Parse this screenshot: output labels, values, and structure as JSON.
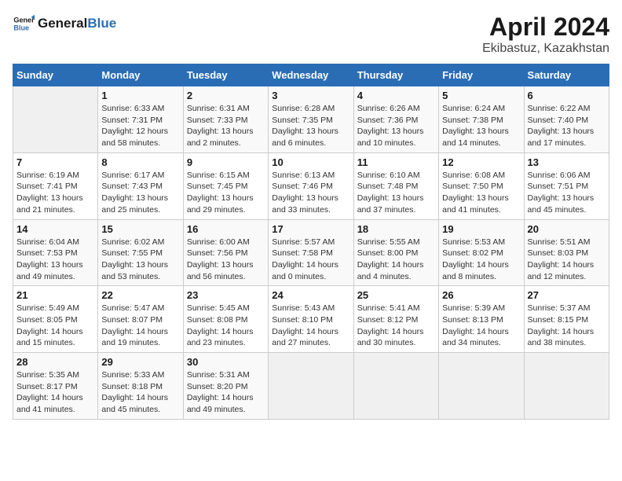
{
  "header": {
    "logo_general": "General",
    "logo_blue": "Blue",
    "title": "April 2024",
    "subtitle": "Ekibastuz, Kazakhstan"
  },
  "calendar": {
    "days_of_week": [
      "Sunday",
      "Monday",
      "Tuesday",
      "Wednesday",
      "Thursday",
      "Friday",
      "Saturday"
    ],
    "weeks": [
      [
        {
          "day": "",
          "sunrise": "",
          "sunset": "",
          "daylight": ""
        },
        {
          "day": "1",
          "sunrise": "Sunrise: 6:33 AM",
          "sunset": "Sunset: 7:31 PM",
          "daylight": "Daylight: 12 hours and 58 minutes."
        },
        {
          "day": "2",
          "sunrise": "Sunrise: 6:31 AM",
          "sunset": "Sunset: 7:33 PM",
          "daylight": "Daylight: 13 hours and 2 minutes."
        },
        {
          "day": "3",
          "sunrise": "Sunrise: 6:28 AM",
          "sunset": "Sunset: 7:35 PM",
          "daylight": "Daylight: 13 hours and 6 minutes."
        },
        {
          "day": "4",
          "sunrise": "Sunrise: 6:26 AM",
          "sunset": "Sunset: 7:36 PM",
          "daylight": "Daylight: 13 hours and 10 minutes."
        },
        {
          "day": "5",
          "sunrise": "Sunrise: 6:24 AM",
          "sunset": "Sunset: 7:38 PM",
          "daylight": "Daylight: 13 hours and 14 minutes."
        },
        {
          "day": "6",
          "sunrise": "Sunrise: 6:22 AM",
          "sunset": "Sunset: 7:40 PM",
          "daylight": "Daylight: 13 hours and 17 minutes."
        }
      ],
      [
        {
          "day": "7",
          "sunrise": "Sunrise: 6:19 AM",
          "sunset": "Sunset: 7:41 PM",
          "daylight": "Daylight: 13 hours and 21 minutes."
        },
        {
          "day": "8",
          "sunrise": "Sunrise: 6:17 AM",
          "sunset": "Sunset: 7:43 PM",
          "daylight": "Daylight: 13 hours and 25 minutes."
        },
        {
          "day": "9",
          "sunrise": "Sunrise: 6:15 AM",
          "sunset": "Sunset: 7:45 PM",
          "daylight": "Daylight: 13 hours and 29 minutes."
        },
        {
          "day": "10",
          "sunrise": "Sunrise: 6:13 AM",
          "sunset": "Sunset: 7:46 PM",
          "daylight": "Daylight: 13 hours and 33 minutes."
        },
        {
          "day": "11",
          "sunrise": "Sunrise: 6:10 AM",
          "sunset": "Sunset: 7:48 PM",
          "daylight": "Daylight: 13 hours and 37 minutes."
        },
        {
          "day": "12",
          "sunrise": "Sunrise: 6:08 AM",
          "sunset": "Sunset: 7:50 PM",
          "daylight": "Daylight: 13 hours and 41 minutes."
        },
        {
          "day": "13",
          "sunrise": "Sunrise: 6:06 AM",
          "sunset": "Sunset: 7:51 PM",
          "daylight": "Daylight: 13 hours and 45 minutes."
        }
      ],
      [
        {
          "day": "14",
          "sunrise": "Sunrise: 6:04 AM",
          "sunset": "Sunset: 7:53 PM",
          "daylight": "Daylight: 13 hours and 49 minutes."
        },
        {
          "day": "15",
          "sunrise": "Sunrise: 6:02 AM",
          "sunset": "Sunset: 7:55 PM",
          "daylight": "Daylight: 13 hours and 53 minutes."
        },
        {
          "day": "16",
          "sunrise": "Sunrise: 6:00 AM",
          "sunset": "Sunset: 7:56 PM",
          "daylight": "Daylight: 13 hours and 56 minutes."
        },
        {
          "day": "17",
          "sunrise": "Sunrise: 5:57 AM",
          "sunset": "Sunset: 7:58 PM",
          "daylight": "Daylight: 14 hours and 0 minutes."
        },
        {
          "day": "18",
          "sunrise": "Sunrise: 5:55 AM",
          "sunset": "Sunset: 8:00 PM",
          "daylight": "Daylight: 14 hours and 4 minutes."
        },
        {
          "day": "19",
          "sunrise": "Sunrise: 5:53 AM",
          "sunset": "Sunset: 8:02 PM",
          "daylight": "Daylight: 14 hours and 8 minutes."
        },
        {
          "day": "20",
          "sunrise": "Sunrise: 5:51 AM",
          "sunset": "Sunset: 8:03 PM",
          "daylight": "Daylight: 14 hours and 12 minutes."
        }
      ],
      [
        {
          "day": "21",
          "sunrise": "Sunrise: 5:49 AM",
          "sunset": "Sunset: 8:05 PM",
          "daylight": "Daylight: 14 hours and 15 minutes."
        },
        {
          "day": "22",
          "sunrise": "Sunrise: 5:47 AM",
          "sunset": "Sunset: 8:07 PM",
          "daylight": "Daylight: 14 hours and 19 minutes."
        },
        {
          "day": "23",
          "sunrise": "Sunrise: 5:45 AM",
          "sunset": "Sunset: 8:08 PM",
          "daylight": "Daylight: 14 hours and 23 minutes."
        },
        {
          "day": "24",
          "sunrise": "Sunrise: 5:43 AM",
          "sunset": "Sunset: 8:10 PM",
          "daylight": "Daylight: 14 hours and 27 minutes."
        },
        {
          "day": "25",
          "sunrise": "Sunrise: 5:41 AM",
          "sunset": "Sunset: 8:12 PM",
          "daylight": "Daylight: 14 hours and 30 minutes."
        },
        {
          "day": "26",
          "sunrise": "Sunrise: 5:39 AM",
          "sunset": "Sunset: 8:13 PM",
          "daylight": "Daylight: 14 hours and 34 minutes."
        },
        {
          "day": "27",
          "sunrise": "Sunrise: 5:37 AM",
          "sunset": "Sunset: 8:15 PM",
          "daylight": "Daylight: 14 hours and 38 minutes."
        }
      ],
      [
        {
          "day": "28",
          "sunrise": "Sunrise: 5:35 AM",
          "sunset": "Sunset: 8:17 PM",
          "daylight": "Daylight: 14 hours and 41 minutes."
        },
        {
          "day": "29",
          "sunrise": "Sunrise: 5:33 AM",
          "sunset": "Sunset: 8:18 PM",
          "daylight": "Daylight: 14 hours and 45 minutes."
        },
        {
          "day": "30",
          "sunrise": "Sunrise: 5:31 AM",
          "sunset": "Sunset: 8:20 PM",
          "daylight": "Daylight: 14 hours and 49 minutes."
        },
        {
          "day": "",
          "sunrise": "",
          "sunset": "",
          "daylight": ""
        },
        {
          "day": "",
          "sunrise": "",
          "sunset": "",
          "daylight": ""
        },
        {
          "day": "",
          "sunrise": "",
          "sunset": "",
          "daylight": ""
        },
        {
          "day": "",
          "sunrise": "",
          "sunset": "",
          "daylight": ""
        }
      ]
    ]
  }
}
